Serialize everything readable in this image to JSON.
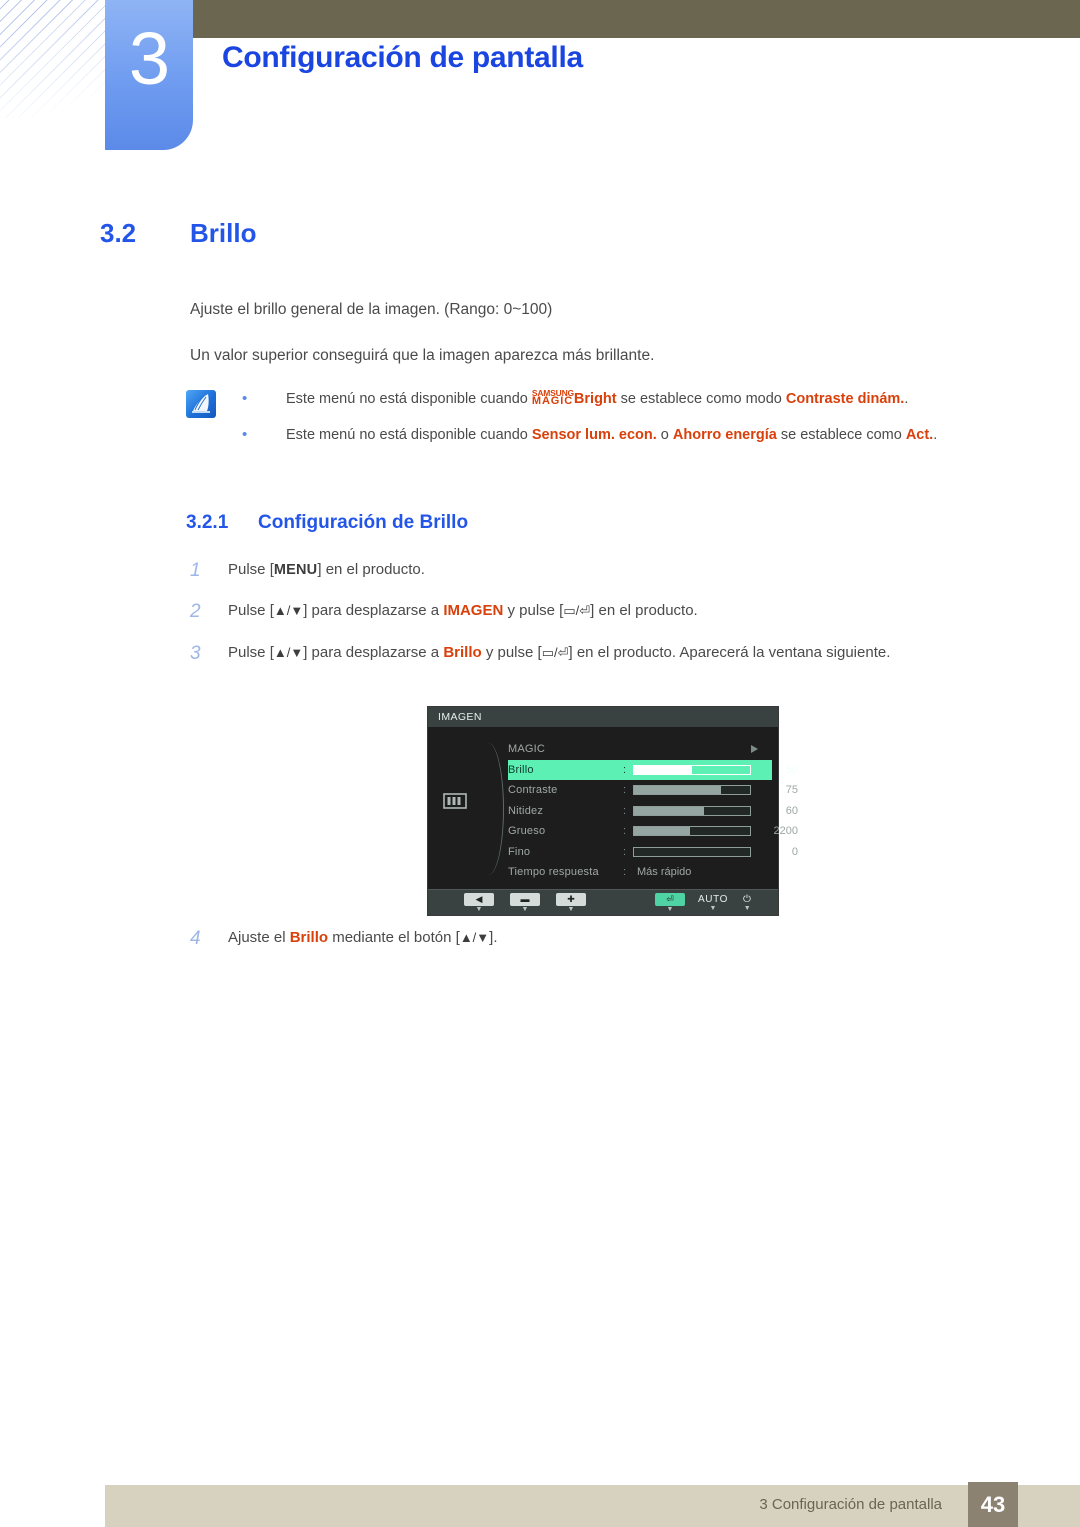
{
  "header": {
    "chapter_number": "3",
    "chapter_title": "Configuración de pantalla"
  },
  "section": {
    "number": "3.2",
    "title": "Brillo",
    "paragraph_1": "Ajuste el brillo general de la imagen. (Rango: 0~100)",
    "paragraph_2": "Un valor superior conseguirá que la imagen aparezca más brillante."
  },
  "note": {
    "icon": "note-pen-icon",
    "items": [
      {
        "pre": "Este menú no está disponible cuando ",
        "magic_top": "SAMSUNG",
        "magic_bottom": "MAGIC",
        "magic_suffix": "Bright",
        "mid": " se establece como modo ",
        "highlight_1": "Contraste dinám.",
        "post": "."
      },
      {
        "pre": "Este menú no está disponible cuando ",
        "highlight_1": "Sensor lum. econ.",
        "mid": " o ",
        "highlight_2": "Ahorro energía",
        "post": " se establece como ",
        "highlight_3": "Act.",
        "tail": "."
      }
    ]
  },
  "subsection": {
    "number": "3.2.1",
    "title": "Configuración de Brillo"
  },
  "steps": [
    {
      "n": "1",
      "parts": [
        {
          "t": "Pulse ["
        },
        {
          "t": "MENU",
          "style": "key"
        },
        {
          "t": "] en el producto."
        }
      ]
    },
    {
      "n": "2",
      "parts": [
        {
          "t": "Pulse ["
        },
        {
          "t": "▲/▼",
          "style": "gl"
        },
        {
          "t": "] para desplazarse a "
        },
        {
          "t": "IMAGEN",
          "style": "hl"
        },
        {
          "t": " y pulse ["
        },
        {
          "t": "▭/⏎",
          "style": "gl"
        },
        {
          "t": "] en el producto."
        }
      ]
    },
    {
      "n": "3",
      "parts": [
        {
          "t": "Pulse ["
        },
        {
          "t": "▲/▼",
          "style": "gl"
        },
        {
          "t": "] para desplazarse a "
        },
        {
          "t": "Brillo",
          "style": "hl"
        },
        {
          "t": " y pulse ["
        },
        {
          "t": "▭/⏎",
          "style": "gl"
        },
        {
          "t": "] en el producto. Aparecerá la ventana siguiente."
        }
      ]
    },
    {
      "n": "4",
      "parts": [
        {
          "t": "Ajuste el "
        },
        {
          "t": "Brillo",
          "style": "hl"
        },
        {
          "t": " mediante el botón ["
        },
        {
          "t": "▲/▼",
          "style": "gl"
        },
        {
          "t": "]."
        }
      ]
    }
  ],
  "osd": {
    "title": "IMAGEN",
    "side_icon": "picture-bars-icon",
    "rows": [
      {
        "label": "MAGIC",
        "kind": "arrow",
        "value": "",
        "fill_pct": 0
      },
      {
        "label": "Brillo",
        "kind": "slider",
        "value": "50",
        "fill_pct": 50,
        "selected": true
      },
      {
        "label": "Contraste",
        "kind": "slider",
        "value": "75",
        "fill_pct": 75
      },
      {
        "label": "Nitidez",
        "kind": "slider",
        "value": "60",
        "fill_pct": 60
      },
      {
        "label": "Grueso",
        "kind": "slider",
        "value": "2200",
        "fill_pct": 48
      },
      {
        "label": "Fino",
        "kind": "slider",
        "value": "0",
        "fill_pct": 0
      },
      {
        "label": "Tiempo respuesta",
        "kind": "text",
        "value": "Más rápido",
        "fill_pct": 0
      }
    ],
    "footer_buttons": [
      {
        "glyph": "◀",
        "name": "osd-back-button",
        "style": "light"
      },
      {
        "glyph": "▬",
        "name": "osd-minus-button",
        "style": "light"
      },
      {
        "glyph": "✚",
        "name": "osd-plus-button",
        "style": "light"
      },
      {
        "glyph": "⏎",
        "name": "osd-enter-button",
        "style": "green"
      },
      {
        "glyph": "AUTO",
        "name": "osd-auto-button",
        "style": "text"
      },
      {
        "glyph": "⏻",
        "name": "osd-power-button",
        "style": "text"
      }
    ]
  },
  "footer": {
    "text": "3 Configuración de pantalla",
    "page_number": "43"
  },
  "colors": {
    "heading_blue": "#2255e8",
    "chapter_blue": "#1a45e0",
    "badge_blue": "#6f9cf0",
    "olive": "#6b6650",
    "highlight_orange": "#d9400b",
    "osd_green": "#5df0b4",
    "footer_beige": "#d7d2bf",
    "footer_page_brown": "#8c8272"
  }
}
